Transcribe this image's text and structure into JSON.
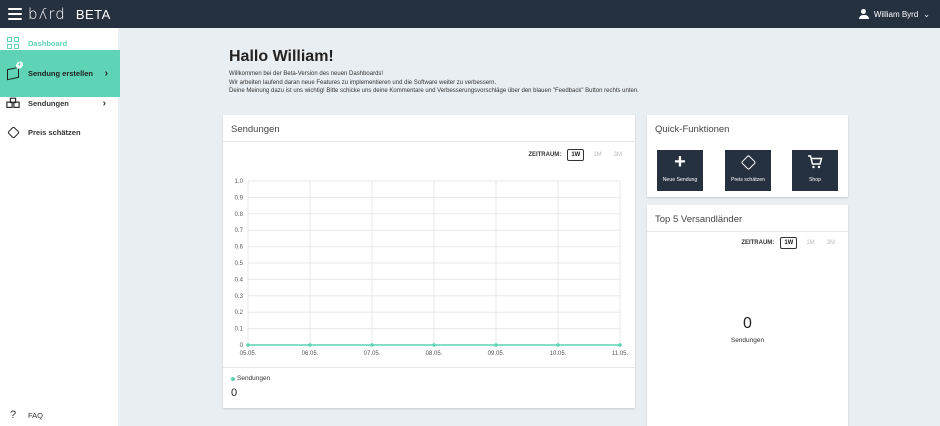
{
  "header": {
    "logo": "bʎrd",
    "badge": "BETA",
    "user_name": "William Byrd",
    "user_chevron": "⌄"
  },
  "sidebar": {
    "items": [
      {
        "label": "Dashboard",
        "icon": "grid-icon"
      },
      {
        "label": "Sendung erstellen",
        "icon": "package-add-icon",
        "arrow": "›"
      },
      {
        "label": "Sendungen",
        "icon": "packages-icon",
        "arrow": "›"
      },
      {
        "label": "Preis schätzen",
        "icon": "tag-icon"
      }
    ],
    "faq": {
      "label": "FAQ",
      "icon": "question-icon",
      "glyph": "?"
    }
  },
  "main": {
    "greeting": "Hallo William!",
    "intro_lines": [
      "Willkommen bei der Beta-Version des neuen Dashboards!",
      "Wir arbeiten laufend daran neue Features zu implementieren und die Software weiter zu verbessern.",
      "Deine Meinung dazu ist uns wichtig! Bitte schicke uns deine Kommentare und Verbesserungsvorschläge über den blauen \"Feedback\" Button rechts unten."
    ]
  },
  "shipments_card": {
    "title": "Sendungen",
    "zeitraum_label": "ZEITRAUM:",
    "options": [
      "1W",
      "1M",
      "3M"
    ],
    "selected": "1W",
    "legend_label": "Sendungen",
    "total": "0"
  },
  "chart_data": {
    "type": "line",
    "x": [
      "05.05.",
      "06.05.",
      "07.05.",
      "08.05.",
      "09.05.",
      "10.05.",
      "11.05."
    ],
    "series": [
      {
        "name": "Sendungen",
        "values": [
          0,
          0,
          0,
          0,
          0,
          0,
          0
        ]
      }
    ],
    "yticks": [
      "0",
      "0.1",
      "0.2",
      "0.3",
      "0.4",
      "0.5",
      "0.6",
      "0.7",
      "0.8",
      "0.9",
      "1.0"
    ],
    "ylim": [
      0,
      1
    ],
    "grid": true,
    "color": "#5fd3b5"
  },
  "quick_functions": {
    "title": "Quick-Funktionen",
    "buttons": [
      {
        "label": "Neue Sendung",
        "icon": "plus-icon",
        "glyph": "+"
      },
      {
        "label": "Preis schätzen",
        "icon": "tag-icon"
      },
      {
        "label": "Shop",
        "icon": "cart-icon",
        "glyph": "🛒"
      }
    ]
  },
  "top5": {
    "title": "Top 5 Versandländer",
    "zeitraum_label": "ZEITRAUM:",
    "options": [
      "1W",
      "1M",
      "3M"
    ],
    "selected": "1W",
    "value": "0",
    "value_label": "Sendungen"
  },
  "colors": {
    "accent": "#5fd3b5",
    "topbar": "#26313f",
    "background": "#e9eef2"
  }
}
